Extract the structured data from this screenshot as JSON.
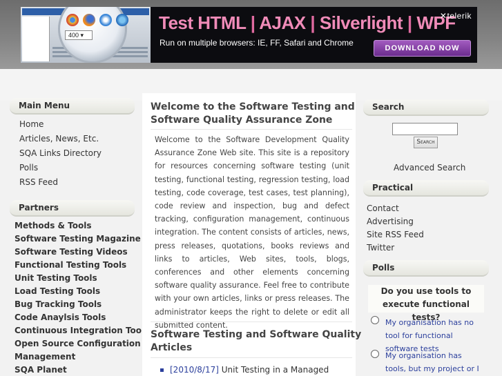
{
  "banner": {
    "title_parts": [
      "Test HTML",
      "AJAX",
      "Silverlight",
      "WPF"
    ],
    "separator": "|",
    "subtitle": "Run on multiple browsers: IE, FF, Safari and Chrome",
    "brand": "telerik",
    "cta_label": "DOWNLOAD NOW",
    "zoom_value": "400"
  },
  "left": {
    "main_menu_title": "Main Menu",
    "main_menu": [
      "Home",
      "Articles, News, Etc.",
      "SQA Links Directory",
      "Polls",
      "RSS Feed"
    ],
    "partners_title": "Partners",
    "partners": [
      "Methods & Tools",
      "Software Testing Magazine",
      "Software Testing Videos",
      "Functional Testing Tools",
      "Unit Testing Tools",
      "Load Testing Tools",
      "Bug Tracking Tools",
      "Code Anaylsis Tools",
      "Continuous Integration Tools",
      "Open Source Configuration",
      "Management",
      "SQA Planet"
    ]
  },
  "main": {
    "welcome_title_1": "Welcome to the Software Testing and",
    "welcome_title_2": "Software Quality Assurance Zone",
    "welcome_text": "Welcome to the Software Development Quality Assurance Zone Web site. This site is a repository for resources concerning software testing (unit testing, functional testing, regression testing, load testing, code coverage, test cases, test planning), code review and inspection, bug and defect tracking, configuration management, continuous integration. The content consists of articles, news, press releases, quotations, books reviews and links to articles, Web sites, tools, blogs, conferences and other elements concerning software quality assurance. Feel free to contribute with your own articles, links or press releases. The administrator keeps the right to delete or edit all submitted content.",
    "articles_title_1": "Software Testing and Software Quality",
    "articles_title_2": "Articles",
    "news_date": "[2010/8/17]",
    "news_title": "Unit Testing in a Managed"
  },
  "right": {
    "search_title": "Search",
    "search_button": "Search",
    "advanced_search": "Advanced Search",
    "practical_title": "Practical",
    "practical_links": [
      "Contact",
      "Advertising",
      "Site RSS Feed",
      "Twitter"
    ],
    "polls_title": "Polls",
    "poll_question": "Do you use tools to execute functional tests?",
    "poll_options": [
      "My organisation has no tool for functional software tests",
      "My organisation has tools, but my project or I do not"
    ]
  }
}
